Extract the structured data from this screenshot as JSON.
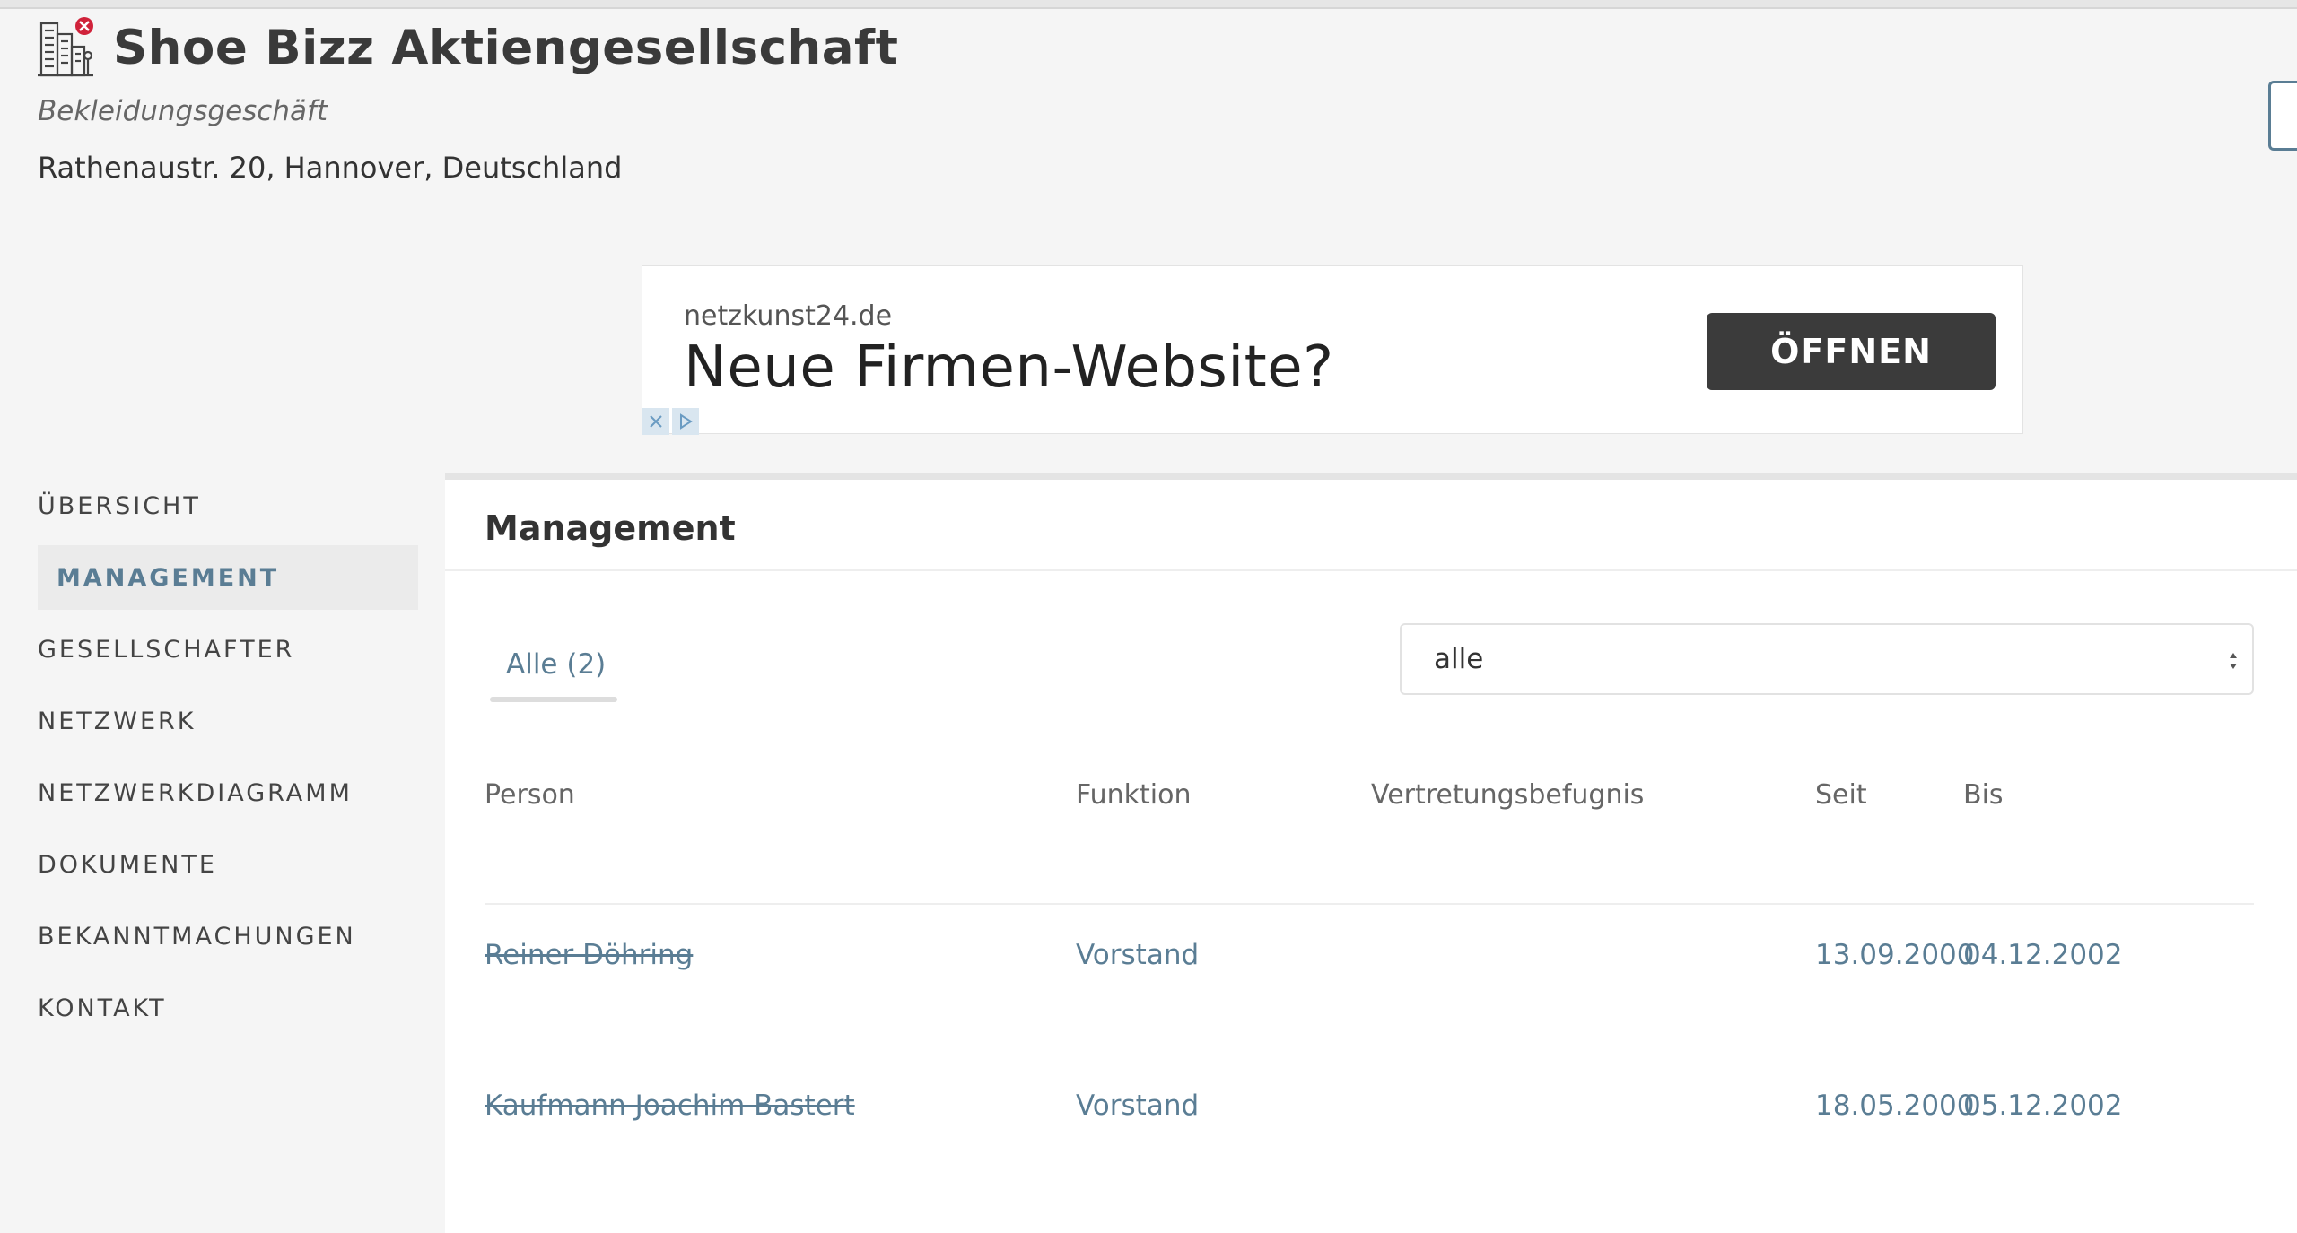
{
  "company": {
    "name": "Shoe Bizz Aktiengesellschaft",
    "type": "Bekleidungsgeschäft",
    "address": "Rathenaustr. 20, Hannover, Deutschland",
    "icon": "building-inactive-icon"
  },
  "ad": {
    "domain": "netzkunst24.de",
    "headline": "Neue Firmen-Website?",
    "button_label": "ÖFFNEN"
  },
  "sidebar": {
    "items": [
      {
        "label": "ÜBERSICHT"
      },
      {
        "label": "MANAGEMENT",
        "active": true
      },
      {
        "label": "GESELLSCHAFTER"
      },
      {
        "label": "NETZWERK"
      },
      {
        "label": "NETZWERKDIAGRAMM"
      },
      {
        "label": "DOKUMENTE"
      },
      {
        "label": "BEKANNTMACHUNGEN"
      },
      {
        "label": "KONTAKT"
      }
    ]
  },
  "main": {
    "title": "Management",
    "tab_label": "Alle (2)",
    "filter": {
      "selected": "alle"
    },
    "columns": [
      "Person",
      "Funktion",
      "Vertretungsbefugnis",
      "Seit",
      "Bis"
    ],
    "rows": [
      {
        "person": "Reiner Döhring",
        "funktion": "Vorstand",
        "vertretung": "",
        "seit": "13.09.2000",
        "bis": "04.12.2002"
      },
      {
        "person": "Kaufmann Joachim Bastert",
        "funktion": "Vorstand",
        "vertretung": "",
        "seit": "18.05.2000",
        "bis": "05.12.2002"
      }
    ]
  },
  "colors": {
    "accent": "#5a7d94",
    "ad_button": "#3b3b3b",
    "background": "#f5f5f5"
  }
}
